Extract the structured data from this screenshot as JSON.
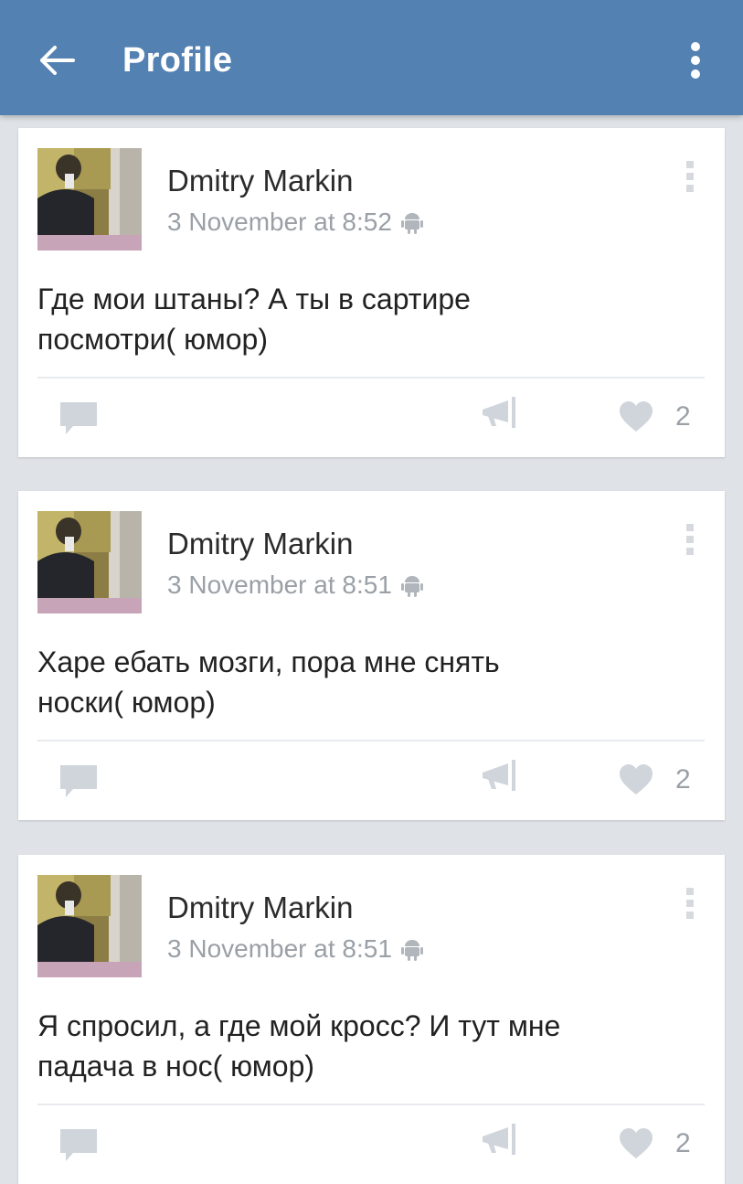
{
  "appbar": {
    "title": "Profile",
    "back_icon": "arrow-left-icon",
    "menu_icon": "more-vertical-icon",
    "color": "#5381b2"
  },
  "posts": [
    {
      "author": "Dmitry Markin",
      "time": "3 November at 8:52",
      "text_line1": "Где мои штаны? А ты в сартире",
      "text_line2": "посмотри( юмор)",
      "likes": "2"
    },
    {
      "author": "Dmitry Markin",
      "time": "3 November at 8:51",
      "text_line1": "Харе ебать мозги, пора мне снять",
      "text_line2": "носки( юмор)",
      "likes": "2"
    },
    {
      "author": "Dmitry Markin",
      "time": "3 November at 8:51",
      "text_line1": "Я спросил, а где мой кросс? И тут мне",
      "text_line2": "падача в нос( юмор)",
      "likes": "2"
    }
  ],
  "icons": {
    "comment": "comment-icon",
    "share": "megaphone-icon",
    "like": "heart-icon",
    "platform": "android-icon"
  },
  "colors": {
    "background": "#dfe3e7",
    "card": "#ffffff",
    "muted_icon": "#cfd5db",
    "meta_text": "#9aa0a6"
  }
}
